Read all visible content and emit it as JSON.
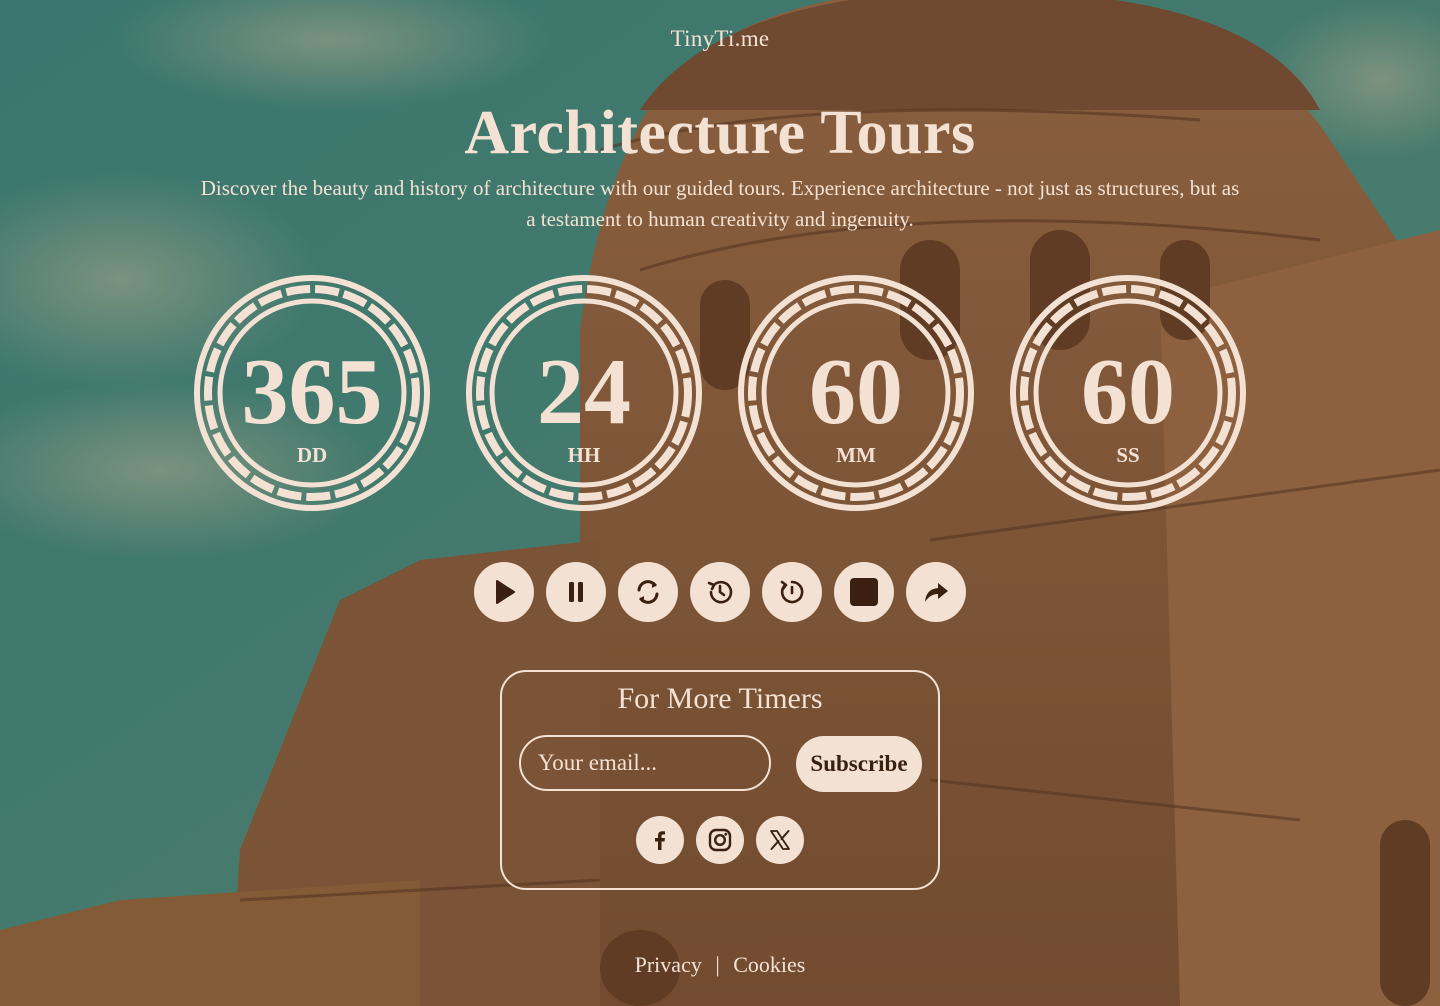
{
  "brand": "TinyTi.me",
  "title": "Architecture Tours",
  "description": "Discover the beauty and history of architecture with our guided tours. Experience architecture - not just as structures, but as a testament to human creativity and ingenuity.",
  "timers": [
    {
      "value": "365",
      "label": "DD"
    },
    {
      "value": "24",
      "label": "HH"
    },
    {
      "value": "60",
      "label": "MM"
    },
    {
      "value": "60",
      "label": "SS"
    }
  ],
  "controls": [
    "play-icon",
    "pause-icon",
    "refresh-icon",
    "history-icon",
    "restart-icon",
    "stop-icon",
    "share-icon"
  ],
  "subscribe": {
    "heading": "For More Timers",
    "email_placeholder": "Your email...",
    "button_label": "Subscribe"
  },
  "social": [
    "facebook-icon",
    "instagram-icon",
    "x-icon"
  ],
  "footer": {
    "privacy": "Privacy",
    "separator": "|",
    "cookies": "Cookies"
  },
  "colors": {
    "accent": "#f3e2d4",
    "dark": "#3a2010",
    "sky": "#3f8a80",
    "stone": "#b07c4f"
  }
}
